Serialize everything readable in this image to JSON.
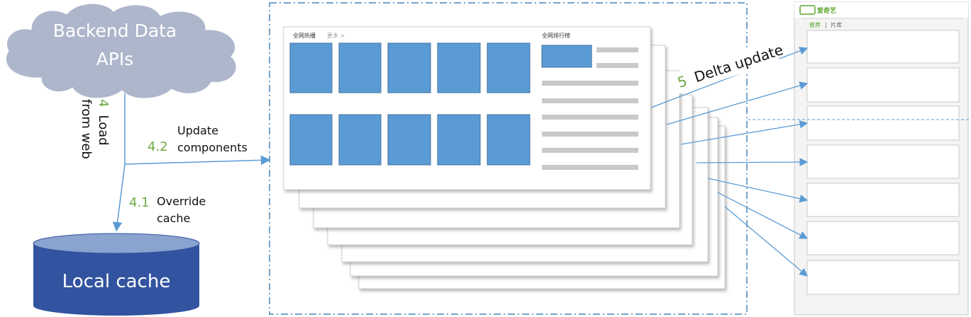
{
  "cloud": {
    "line1": "Backend Data",
    "line2": "APIs"
  },
  "cache": {
    "label": "Local cache"
  },
  "step4": {
    "number": "4",
    "line1": "Load",
    "line2": "from web"
  },
  "step4_1": {
    "number": "4.1",
    "line1": "Override",
    "line2": "cache"
  },
  "step4_2": {
    "number": "4.2",
    "line1": "Update",
    "line2": "components"
  },
  "step5": {
    "number": "5",
    "label": "Delta update"
  },
  "page_card": {
    "hot_title": "全网热播",
    "more_link": "更多 >",
    "rank_title": "全网排行榜"
  },
  "phone": {
    "logo": "爱奇艺",
    "tab_recommend": "推荐",
    "tab_separator": "|",
    "tab_library": "片库"
  },
  "colors": {
    "cloud_fill": "#adb6cb",
    "cylinder_body": "#3253a0",
    "cylinder_top": "#8aa3cf",
    "tile_blue": "#5b9bd5",
    "arrow": "#5b9bd5",
    "accent_green": "#70a844",
    "dash_border": "#4a86b8",
    "bar_grey": "#c9c9c9"
  }
}
